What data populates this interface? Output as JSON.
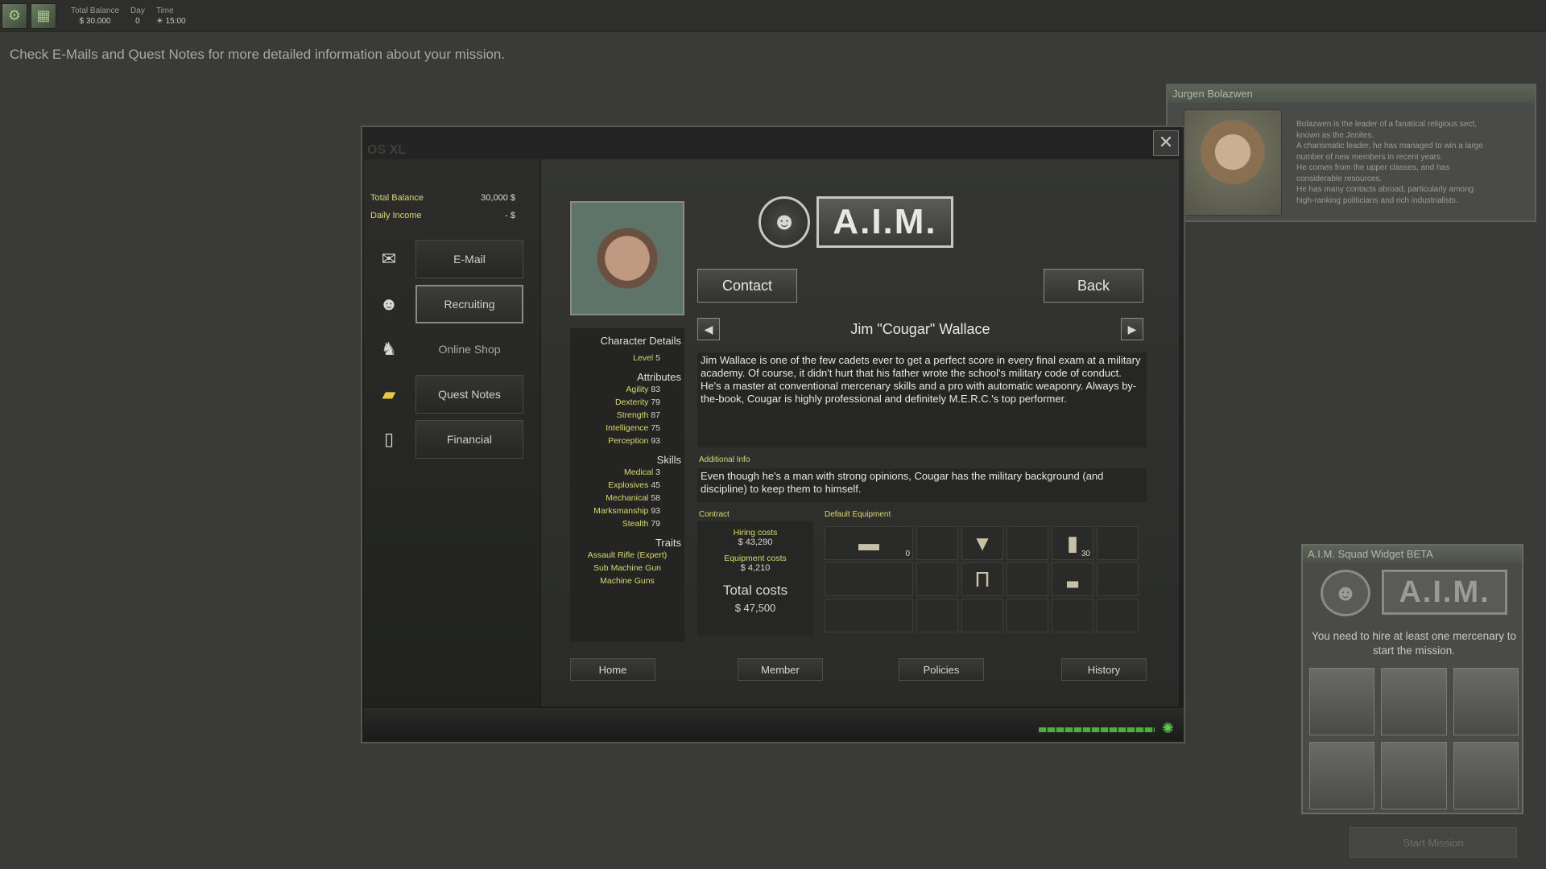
{
  "topbar": {
    "balance_label": "Total Balance",
    "balance_value": "$ 30.000",
    "day_label": "Day",
    "day_value": "0",
    "time_label": "Time",
    "time_value": "15:00"
  },
  "hint": "Check E-Mails and Quest Notes for more detailed information about your mission.",
  "npc": {
    "name": "Jurgen Bolazwen",
    "lines": [
      "Bolazwen is the leader of a fanatical religious sect,",
      "known as the Jenites.",
      "A charismatic leader, he has managed to win a large",
      "number of new members in recent years.",
      "He comes from the upper classes, and has",
      "considerable resources.",
      "He has many contacts abroad, particularly among",
      "high-ranking politicians and rich industrialists."
    ]
  },
  "laptop": {
    "title": "OS XL",
    "balance": {
      "label": "Total Balance",
      "value": "30,000 $"
    },
    "income": {
      "label": "Daily Income",
      "value": "- $"
    },
    "nav": [
      {
        "label": "E-Mail"
      },
      {
        "label": "Recruiting"
      },
      {
        "label": "Online Shop"
      },
      {
        "label": "Quest Notes"
      },
      {
        "label": "Financial"
      }
    ]
  },
  "aim": {
    "logo_text": "A.I.M.",
    "contact_label": "Contact",
    "back_label": "Back",
    "merc_name": "Jim \"Cougar\" Wallace",
    "details_title": "Character Details",
    "level_label": "Level",
    "level_value": "5",
    "attributes_title": "Attributes",
    "attributes": [
      {
        "name": "Agility",
        "value": "83"
      },
      {
        "name": "Dexterity",
        "value": "79"
      },
      {
        "name": "Strength",
        "value": "87"
      },
      {
        "name": "Intelligence",
        "value": "75"
      },
      {
        "name": "Perception",
        "value": "93"
      }
    ],
    "skills_title": "Skills",
    "skills": [
      {
        "name": "Medical",
        "value": "3"
      },
      {
        "name": "Explosives",
        "value": "45"
      },
      {
        "name": "Mechanical",
        "value": "58"
      },
      {
        "name": "Marksmanship",
        "value": "93"
      },
      {
        "name": "Stealth",
        "value": "79"
      }
    ],
    "traits_title": "Traits",
    "traits": [
      "Assault Rifle (Expert)",
      "Sub Machine Gun",
      "Machine Guns"
    ],
    "description": "Jim Wallace is one of the few cadets ever to get a perfect score in every final exam at a military academy. Of course, it didn't hurt that his father wrote the school's military code of conduct. He's a master at conventional mercenary skills and a pro with automatic weaponry. Always by-the-book, Cougar is highly professional and definitely M.E.R.C.'s top performer.",
    "additional_label": "Additional Info",
    "additional": "Even though he's a man with strong opinions, Cougar has the military background (and discipline) to keep them to himself.",
    "contract_label": "Contract",
    "hiring_label": "Hiring costs",
    "hiring_value": "$ 43,290",
    "equipment_label": "Equipment costs",
    "equipment_value": "$ 4,210",
    "total_label": "Total costs",
    "total_value": "$ 47,500",
    "default_equipment_label": "Default Equipment",
    "rifle_count": "0",
    "ammo_count": "30",
    "bottom_nav": [
      "Home",
      "Member",
      "Policies",
      "History"
    ]
  },
  "widget": {
    "title": "A.I.M. Squad Widget BETA",
    "logo_text": "A.I.M.",
    "message": "You need to hire at least one mercenary to start the mission.",
    "start_label": "Start Mission"
  },
  "icons": {
    "close": "close-icon",
    "prev": "arrow-left-icon",
    "next": "arrow-right-icon",
    "gear": "gear-icon"
  }
}
